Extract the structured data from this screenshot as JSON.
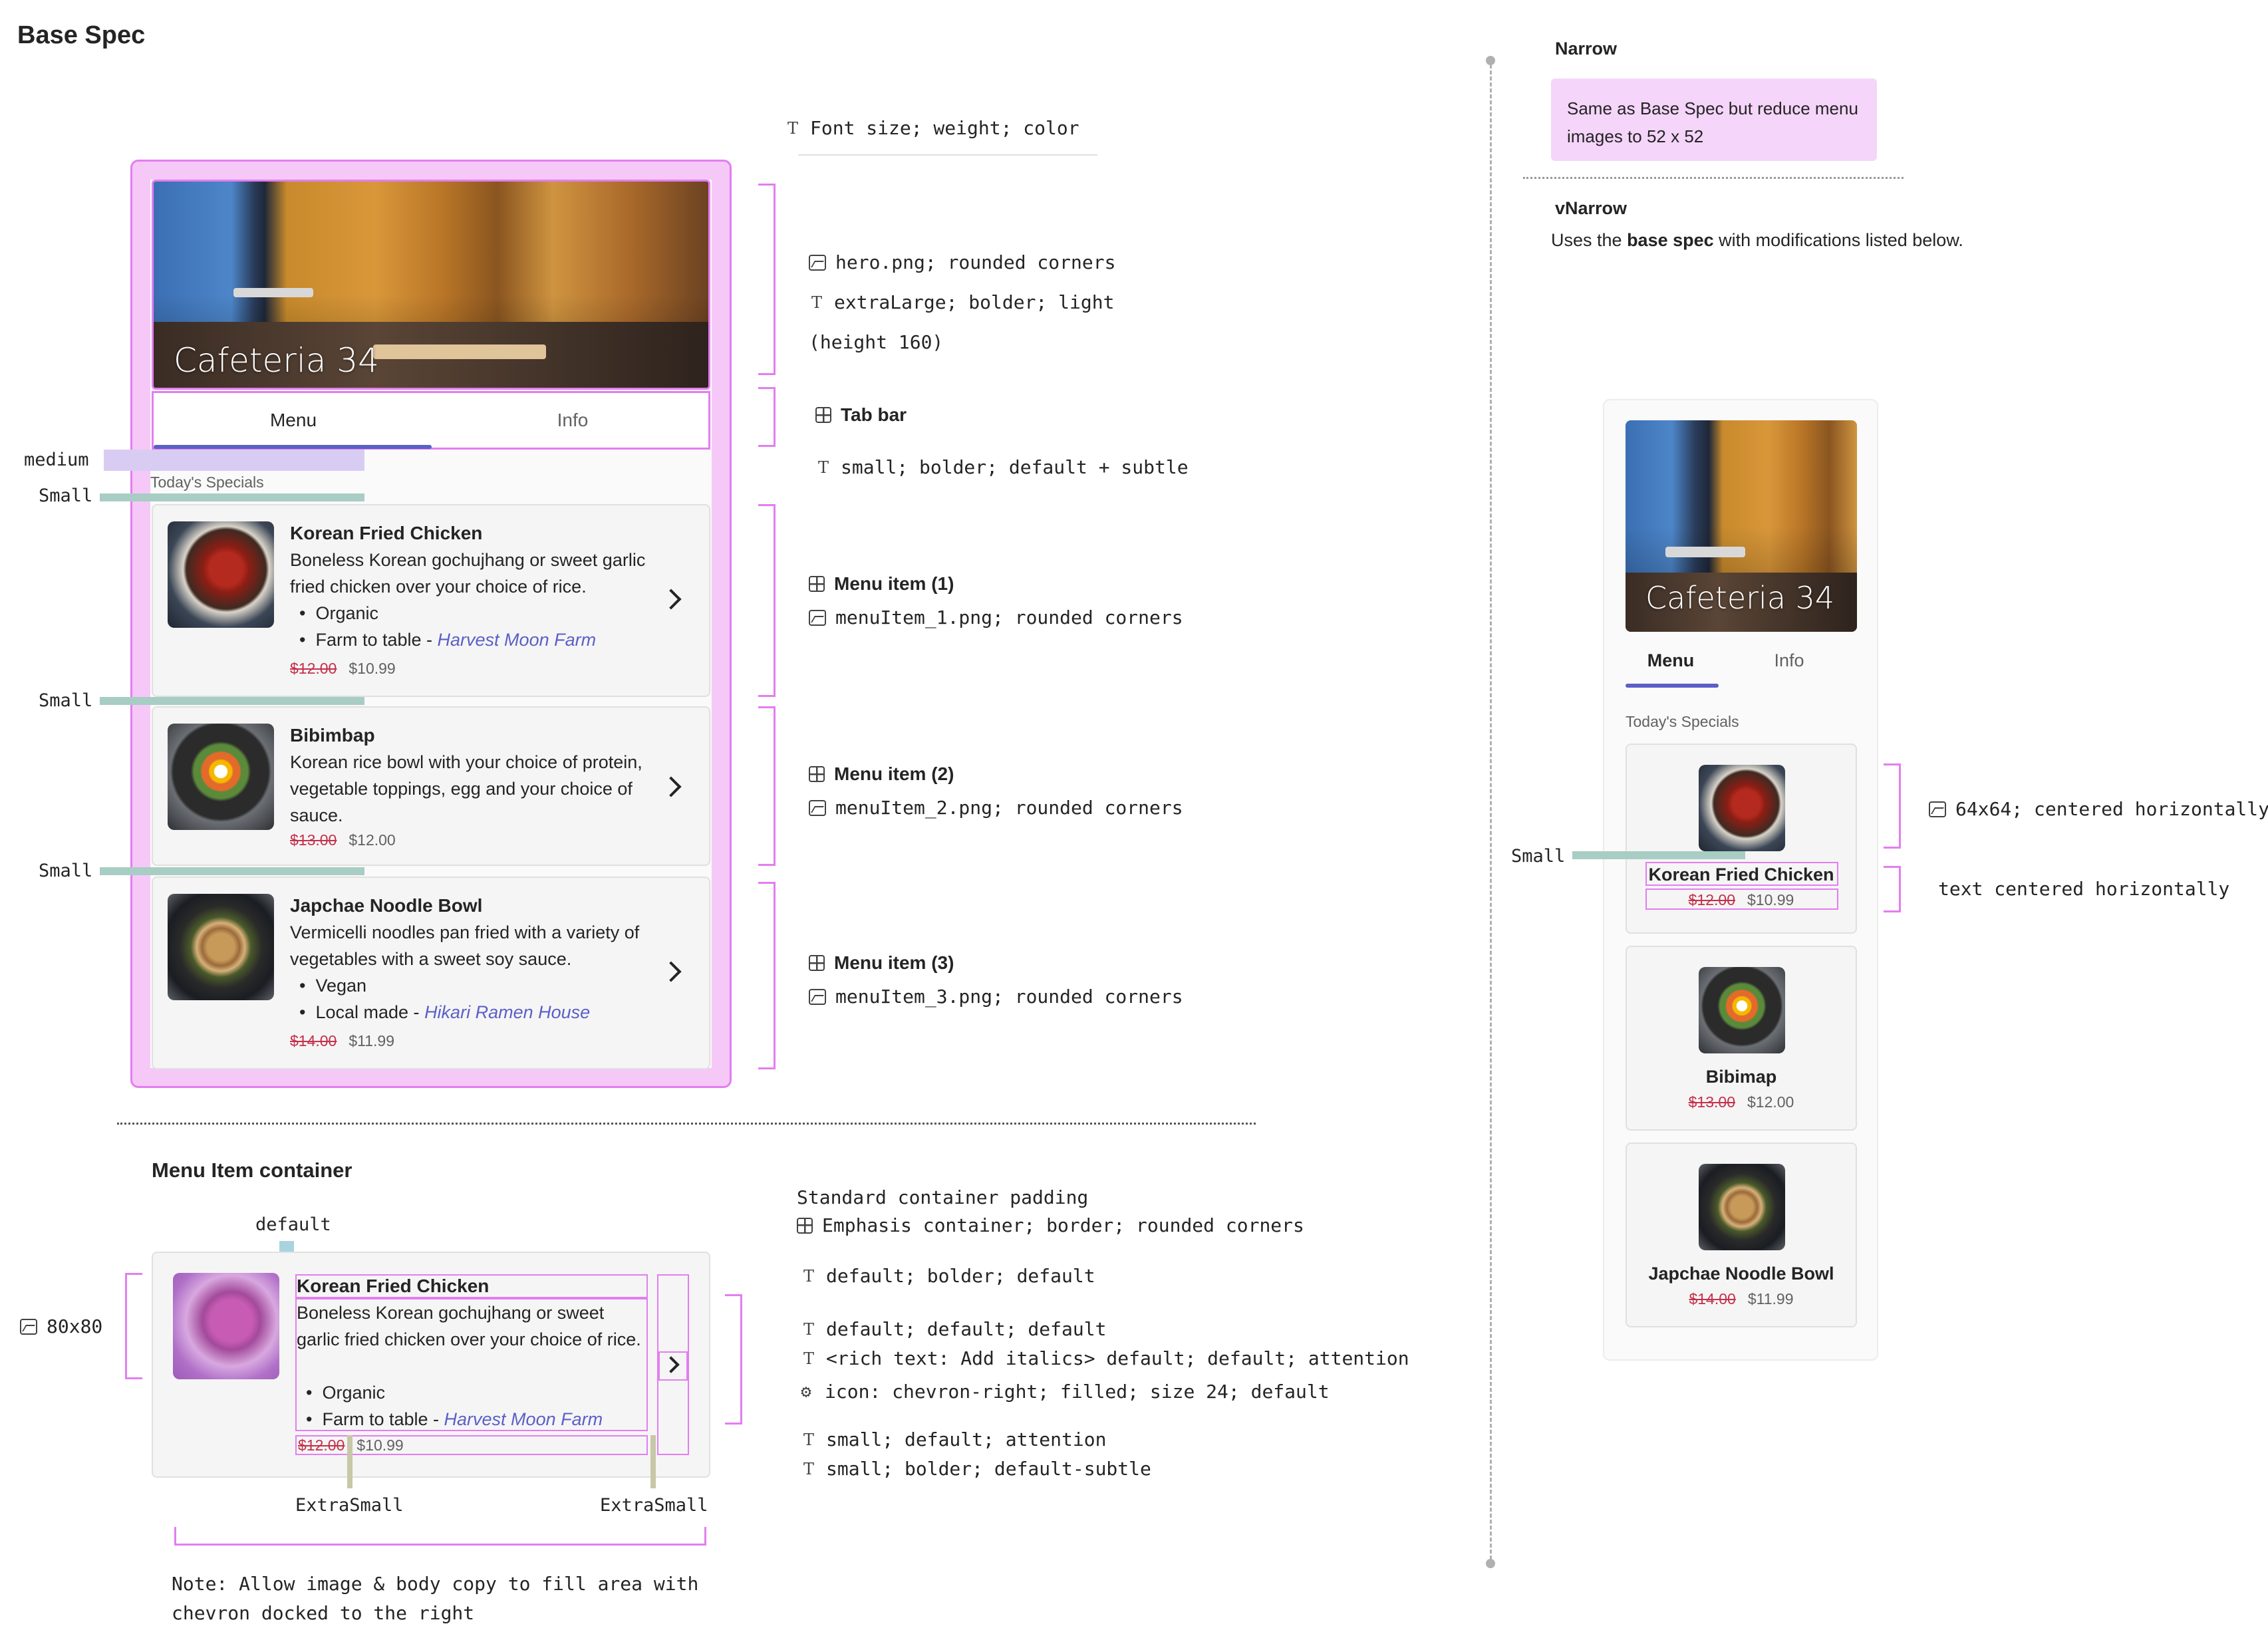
{
  "base_spec": {
    "title": "Base Spec",
    "legend": "Font size; weight; color",
    "hero": {
      "title": "Cafeteria 34",
      "annotations": [
        "hero.png; rounded corners",
        "extraLarge; bolder; light",
        "(height 160)"
      ]
    },
    "tabs": [
      "Menu",
      "Info"
    ],
    "tab_bar_label": "Tab bar",
    "tab_text_annotation": "small; bolder; default + subtle",
    "section_label": "Today's Specials",
    "spacing_labels": {
      "medium": "medium",
      "small": "Small"
    },
    "menu_items": [
      {
        "title": "Korean Fried Chicken",
        "desc": "Boneless Korean gochujhang or sweet garlic fried chicken over your choice of rice.",
        "bullets": [
          {
            "text": "Organic",
            "link": ""
          },
          {
            "text": "Farm to table - ",
            "link": "Harvest Moon Farm"
          }
        ],
        "old_price": "$12.00",
        "new_price": "$10.99",
        "ann_title": "Menu item (1)",
        "ann_image": "menuItem_1.png; rounded corners"
      },
      {
        "title": "Bibimbap",
        "desc": "Korean rice bowl with your choice of protein, vegetable toppings, egg and your choice of sauce.",
        "bullets": [],
        "old_price": "$13.00",
        "new_price": "$12.00",
        "ann_title": "Menu item (2)",
        "ann_image": "menuItem_2.png; rounded corners"
      },
      {
        "title": "Japchae Noodle Bowl",
        "desc": "Vermicelli noodles pan fried with a variety of vegetables with a sweet soy sauce.",
        "bullets": [
          {
            "text": "Vegan",
            "link": ""
          },
          {
            "text": "Local made - ",
            "link": "Hikari Ramen House"
          }
        ],
        "old_price": "$14.00",
        "new_price": "$11.99",
        "ann_title": "Menu item (3)",
        "ann_image": "menuItem_3.png; rounded corners"
      }
    ]
  },
  "container_spec": {
    "title": "Menu Item container",
    "default_label": "default",
    "image_annotation": "80x80",
    "extra_small_label": "ExtraSmall",
    "note": "Note: Allow image & body copy to fill area with chevron docked to the right",
    "annotations": [
      "Standard container padding",
      "Emphasis container; border; rounded corners",
      "default; bolder; default",
      "default; default; default",
      "<rich text: Add italics> default; default; attention",
      "icon: chevron-right; filled; size 24; default",
      "small; default; attention",
      "small; bolder; default-subtle"
    ]
  },
  "narrow": {
    "title": "Narrow",
    "note": "Same as Base Spec but reduce menu images to 52 x 52"
  },
  "vnarrow": {
    "title": "vNarrow",
    "desc_prefix": "Uses the ",
    "desc_bold": "base spec",
    "desc_suffix": " with modifications listed below.",
    "hero_title": "Cafeteria 34",
    "tabs": [
      "Menu",
      "Info"
    ],
    "section_label": "Today's Specials",
    "small_label": "Small",
    "items": [
      {
        "title": "Korean Fried Chicken",
        "old_price": "$12.00",
        "new_price": "$10.99"
      },
      {
        "title": "Bibimap",
        "old_price": "$13.00",
        "new_price": "$12.00"
      },
      {
        "title": "Japchae Noodle Bowl",
        "old_price": "$14.00",
        "new_price": "$11.99"
      }
    ],
    "annotations": [
      "64x64; centered horizontally",
      "text centered horizontally"
    ]
  },
  "colors": {
    "accent": "#5b5fc7",
    "annotation_pink": "#e37ef0",
    "spacing_teal": "#a8cdc4",
    "price_red": "#c4314b"
  }
}
